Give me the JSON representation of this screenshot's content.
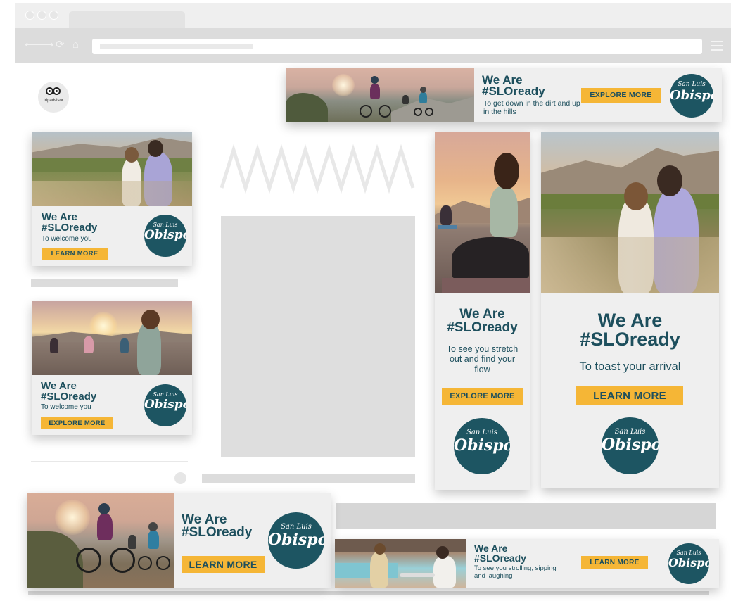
{
  "browser": {
    "nav_icons": [
      "back-icon",
      "forward-icon",
      "refresh-icon",
      "home-icon"
    ],
    "nav_glyphs": [
      "⟵",
      "⟶",
      "⟳",
      "⌂"
    ]
  },
  "brand": {
    "tripadvisor_label": "tripadvisor",
    "logo_line1": "San Luis",
    "logo_line2": "Obispo",
    "colors": {
      "teal": "#1d4f5d",
      "gold": "#f5b636",
      "panel": "#efefef"
    }
  },
  "ads": {
    "leaderboard_top": {
      "headline1": "We Are",
      "headline2": "#SLOready",
      "sub": "To get down in the dirt and up in the hills",
      "cta": "EXPLORE MORE"
    },
    "rect_wine": {
      "headline1": "We Are",
      "headline2": "#SLOready",
      "sub": "To welcome you",
      "cta": "LEARN MORE"
    },
    "rect_yoga": {
      "headline1": "We Are",
      "headline2": "#SLOready",
      "sub": "To welcome you",
      "cta": "EXPLORE MORE"
    },
    "sky_yoga": {
      "headline1": "We Are",
      "headline2": "#SLOready",
      "sub": "To see you stretch out and find your flow",
      "cta": "EXPLORE MORE"
    },
    "half_wine": {
      "headline1": "We Are",
      "headline2": "#SLOready",
      "sub": "To toast your arrival",
      "cta": "LEARN MORE"
    },
    "banner_bike": {
      "headline1": "We Are",
      "headline2": "#SLOready",
      "cta": "LEARN MORE"
    },
    "banner_pool": {
      "headline1": "We Are",
      "headline2": "#SLOready",
      "sub": "To see you strolling, sipping and laughing",
      "cta": "LEARN MORE"
    }
  }
}
